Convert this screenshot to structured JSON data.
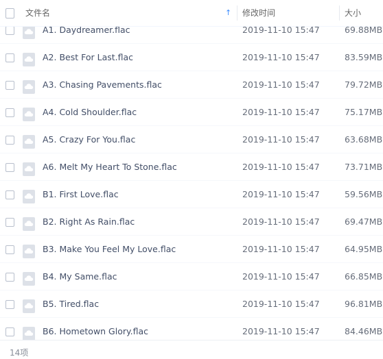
{
  "header": {
    "name_label": "文件名",
    "sort_indicator": "↑",
    "time_label": "修改时间",
    "size_label": "大小"
  },
  "files": [
    {
      "name": "A1. Daydreamer.flac",
      "time": "2019-11-10 15:47",
      "size": "69.88MB"
    },
    {
      "name": "A2. Best For Last.flac",
      "time": "2019-11-10 15:47",
      "size": "83.59MB"
    },
    {
      "name": "A3. Chasing Pavements.flac",
      "time": "2019-11-10 15:47",
      "size": "79.72MB"
    },
    {
      "name": "A4. Cold Shoulder.flac",
      "time": "2019-11-10 15:47",
      "size": "75.17MB"
    },
    {
      "name": "A5. Crazy For You.flac",
      "time": "2019-11-10 15:47",
      "size": "63.68MB"
    },
    {
      "name": "A6. Melt My Heart To Stone.flac",
      "time": "2019-11-10 15:47",
      "size": "73.71MB"
    },
    {
      "name": "B1. First Love.flac",
      "time": "2019-11-10 15:47",
      "size": "59.56MB"
    },
    {
      "name": "B2. Right As Rain.flac",
      "time": "2019-11-10 15:47",
      "size": "69.47MB"
    },
    {
      "name": "B3. Make You Feel My Love.flac",
      "time": "2019-11-10 15:47",
      "size": "64.95MB"
    },
    {
      "name": "B4. My Same.flac",
      "time": "2019-11-10 15:47",
      "size": "66.85MB"
    },
    {
      "name": "B5. Tired.flac",
      "time": "2019-11-10 15:47",
      "size": "96.81MB"
    },
    {
      "name": "B6. Hometown Glory.flac",
      "time": "2019-11-10 15:47",
      "size": "84.46MB"
    }
  ],
  "icons": {
    "file_icon": "cloud-file-icon",
    "sort_icon": "sort-ascending-icon"
  },
  "footer": {
    "count": "14项"
  },
  "colors": {
    "sort_accent": "#3b8cff",
    "text": "#424e67",
    "file_icon_bg": "#dde1e8"
  }
}
